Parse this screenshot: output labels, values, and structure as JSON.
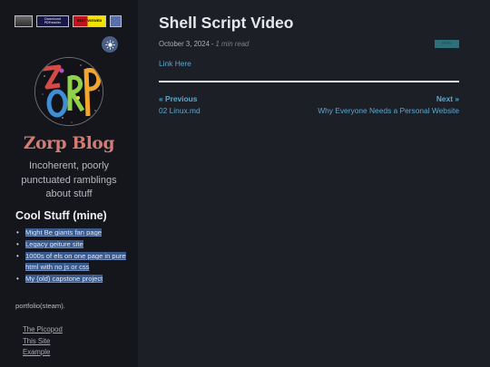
{
  "sidebar": {
    "badges": [
      {
        "icon": "old-computer-badge",
        "text": ""
      },
      {
        "icon": "download-pdfreader-badge",
        "text": "Download PDFreader"
      },
      {
        "icon": "red-yellow-badge",
        "text": "BEST VIEWED"
      },
      {
        "icon": "blue-badge",
        "text": ""
      }
    ],
    "theme_toggle_icon": "sun-icon",
    "avatar_text": "ZORP",
    "blog_title": "Zorp Blog",
    "tagline": "Incoherent, poorly punctuated ramblings about stuff",
    "cool_heading_strong": "Cool Stuff",
    "cool_heading_rest": " (mine)",
    "cool_items": [
      "Might Be giants fan page",
      "Legacy geiture site",
      "1000s of els on one page in pure html with no js or css",
      "My (old) capstone project"
    ],
    "portfolio_text": "portfolio(steam).",
    "links": [
      "The Picopod",
      "This Site",
      "Example"
    ]
  },
  "post": {
    "title": "Shell Script Video",
    "date": "October 3, 2024",
    "separator": "-",
    "read_time": "1 min read",
    "tag": "misc",
    "link_text": "Link Here"
  },
  "nav": {
    "prev_label": "« Previous",
    "prev_title": "02 Linux.md",
    "next_label": "Next »",
    "next_title": "Why Everyone Needs a Personal Website"
  },
  "colors": {
    "background": "#1d1f27",
    "sidebar": "#15161b",
    "accent_link": "#5aa8cf",
    "blog_title": "#d47b74",
    "highlight": "#3a5a8e"
  }
}
